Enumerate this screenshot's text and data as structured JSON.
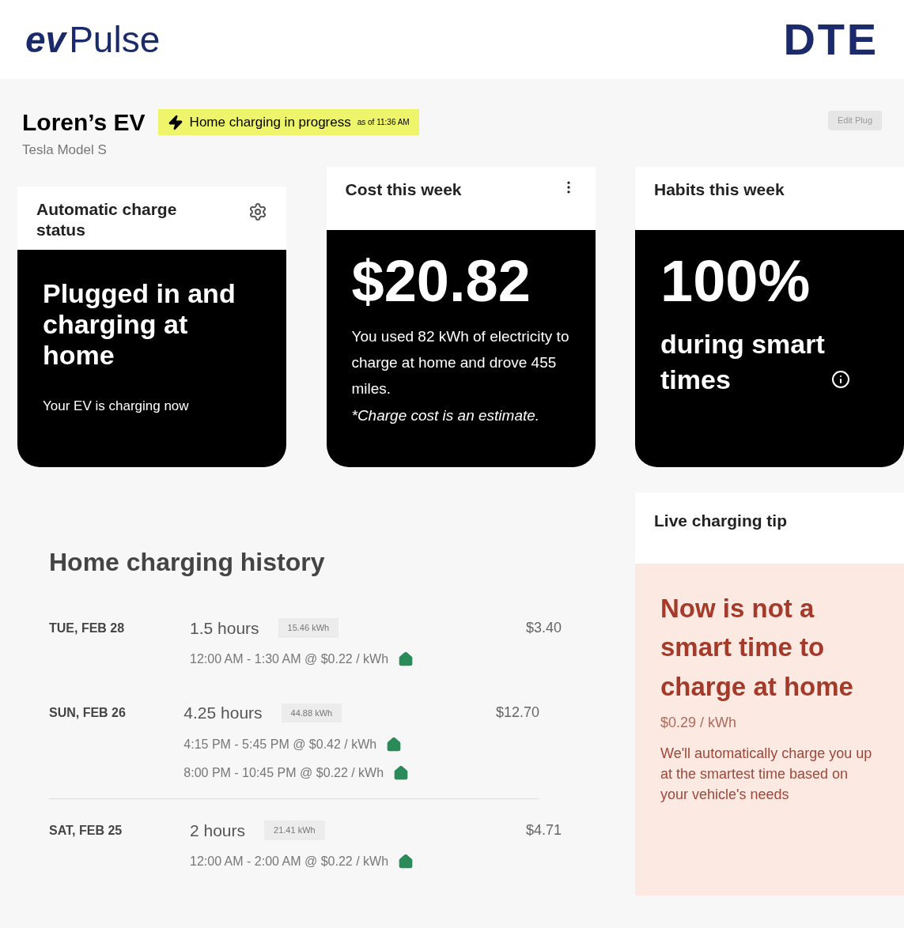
{
  "header": {
    "logo_ev": "ev",
    "logo_pulse": "Pulse",
    "brand": "DTE"
  },
  "vehicle": {
    "name": "Loren’s EV",
    "model": "Tesla Model S",
    "status": "Home charging in progress",
    "status_time": "as of 11:36 AM",
    "edit_button": "Edit Plug"
  },
  "cards": [
    {
      "kind": "status",
      "title": "Automatic charge status",
      "headline": "Plugged in and charging at home",
      "body": "Your EV is charging now"
    },
    {
      "kind": "cost",
      "title": "Cost this week",
      "headline": "$20.82",
      "body": "You used 82 kWh of electricity to charge at home and drove 455 miles.",
      "note": "*Charge cost is an estimate."
    },
    {
      "kind": "habits",
      "title": "Habits this week",
      "headline": "100%",
      "body": "during smart times"
    }
  ],
  "history": {
    "title": "Home charging history",
    "rows": [
      {
        "date": "TUE, FEB 28",
        "duration": "1.5 hours",
        "energy": "15.46 kWh",
        "cost": "$3.40",
        "sessions": [
          "12:00 AM - 1:30 AM @ $0.22 / kWh"
        ]
      },
      {
        "date": "SUN, FEB 26",
        "duration": "4.25 hours",
        "energy": "44.88 kWh",
        "cost": "$12.70",
        "sessions": [
          "4:15 PM - 5:45 PM @ $0.42 / kWh",
          "8:00 PM - 10:45 PM @ $0.22 / kWh"
        ]
      },
      {
        "date": "SAT, FEB 25",
        "duration": "2 hours",
        "energy": "21.41 kWh",
        "cost": "$4.71",
        "sessions": [
          "12:00 AM - 2:00 AM @ $0.22 / kWh"
        ]
      }
    ]
  },
  "tip": {
    "title": "Live charging tip",
    "headline": "Now is not a smart time to charge at home",
    "rate": "$0.29 / kWh",
    "body": "We'll automatically charge you up at the smartest time based on your vehicle's needs"
  }
}
